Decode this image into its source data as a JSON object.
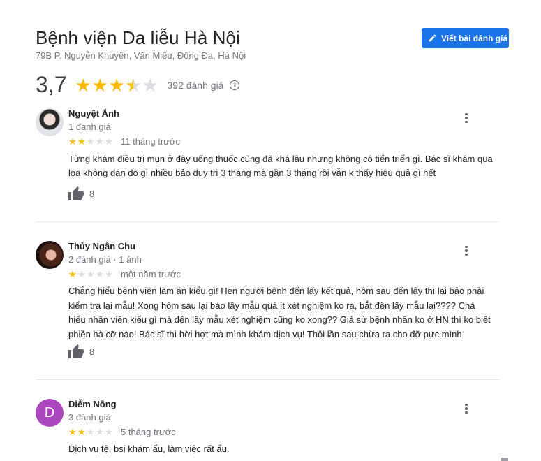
{
  "place": {
    "title": "Bệnh viện Da liễu Hà Nội",
    "address": "79B P. Nguyễn Khuyến, Văn Miếu, Đống Đa, Hà Nội",
    "write_review_label": "Viết bài đánh giá",
    "rating": "3,7",
    "rating_value": 3.7,
    "review_count": "392 đánh giá",
    "star_color": "#fbbc04",
    "button_color": "#1a73e8"
  },
  "reviews": [
    {
      "name": "Nguyệt Ánh",
      "meta": "1 đánh giá",
      "stars": 2,
      "time": "11 tháng trước",
      "text": "Từng khám điều trị mụn ở đây uống thuốc cũng đã khá lâu nhưng không có tiến triển gì. Bác sĩ khám qua loa không dặn dò gì nhiều bảo duy trì 3 tháng mà gần 3 tháng rồi vẫn k thấy hiệu quả gì hết",
      "likes": "8"
    },
    {
      "name": "Thủy Ngân Chu",
      "meta": "2 đánh giá · 1 ảnh",
      "stars": 1,
      "time": "một năm trước",
      "text": "Chẳng hiểu bệnh viện làm ăn kiểu gì! Hẹn người bệnh đến lấy kết quả, hôm sau đến lấy thì lại bảo phải kiểm tra lại mẫu! Xong hôm sau lại bảo lấy mẫu quá ít xét nghiệm ko ra, bắt đến lấy mẫu lại???? Chả hiểu nhân viên kiểu gì mà đến lấy mẫu xét nghiệm cũng ko xong?? Giả sử bệnh nhân ko ở HN thì ko biết phiền hà cỡ nào! Bác sĩ thì hời hợt mà mình khám dịch vụ! Thôi lần sau chừa ra cho đỡ pực mình",
      "likes": "8"
    },
    {
      "name": "Diễm Nông",
      "meta": "3 đánh giá",
      "avatar_letter": "D",
      "avatar_color": "#ab47bc",
      "stars": 2,
      "time": "5 tháng trước",
      "text": "Dịch vụ tệ, bsi khám ẩu, làm việc rất ẩu."
    }
  ]
}
